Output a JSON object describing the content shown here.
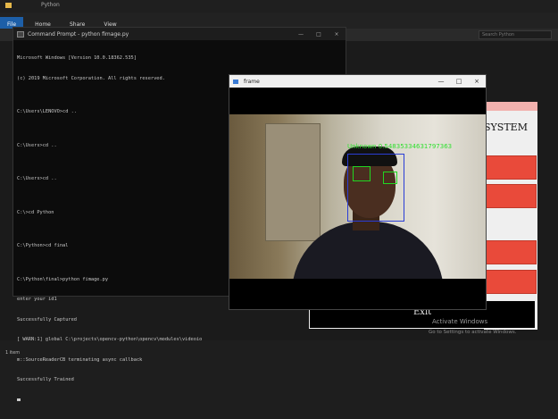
{
  "explorer": {
    "title": "Python",
    "ribbon_tabs": [
      "File",
      "Home",
      "Share",
      "View"
    ],
    "search_placeholder": "Search Python",
    "status": "1 item"
  },
  "cmd": {
    "title": "Command Prompt - python fimage.py",
    "controls": [
      "—",
      "□",
      "×"
    ],
    "lines": [
      "Microsoft Windows [Version 10.0.18362.535]",
      "(c) 2019 Microsoft Corporation. All rights reserved.",
      "",
      "C:\\Users\\LENOVO>cd ..",
      "",
      "C:\\Users>cd ..",
      "",
      "C:\\Users>cd ..",
      "",
      "C:\\>cd Python",
      "",
      "C:\\Python>cd final",
      "",
      "C:\\Python\\final>python fimage.py",
      "enter your id1",
      "Successfully Captured",
      "[ WARN:1] global C:\\projects\\opencv-python\\opencv\\modules\\videoio",
      "m::SourceReaderCB terminating async callback",
      "Successfully Trained"
    ]
  },
  "frame_window": {
    "title": "frame",
    "controls": [
      "—",
      "□",
      "×"
    ],
    "label": "Unknown 0.54835334631797363"
  },
  "app": {
    "title_fragment": "SYSTEM",
    "exit_label": "Exit"
  },
  "watermark": {
    "line1": "Activate Windows",
    "line2": "Go to Settings to activate Windows."
  }
}
